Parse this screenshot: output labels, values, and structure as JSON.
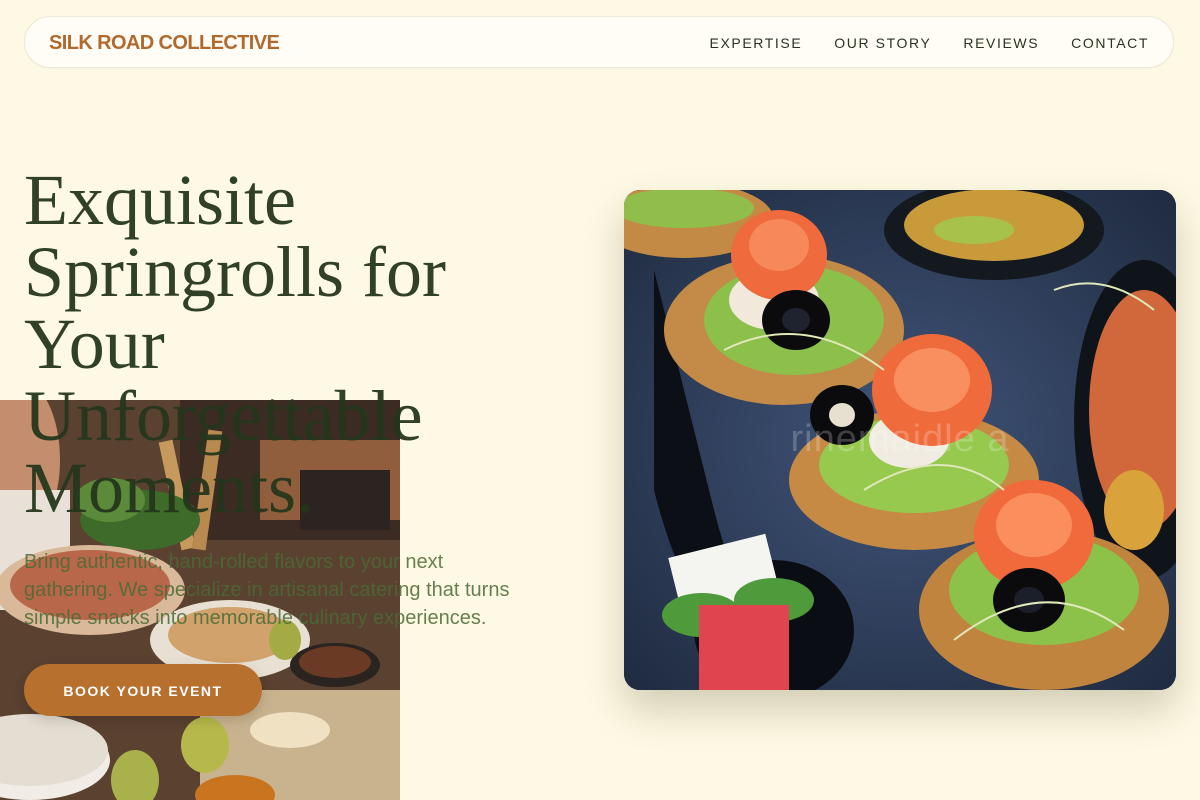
{
  "brand": {
    "name": "SILK ROAD COLLECTIVE",
    "color": "#b06a2d"
  },
  "nav": {
    "items": [
      {
        "label": "EXPERTISE"
      },
      {
        "label": "OUR STORY"
      },
      {
        "label": "REVIEWS"
      },
      {
        "label": "CONTACT"
      }
    ]
  },
  "hero": {
    "title": "Exquisite Springrolls for Your Unforgettable Moments.",
    "subtitle": "Bring authentic, hand-rolled flavors to your next gathering. We specialize in artisanal catering that turns simple snacks into memorable culinary experiences.",
    "cta_label": "BOOK YOUR EVENT"
  },
  "images": {
    "buffet": {
      "subject": "catering-buffet-photo"
    },
    "canapes": {
      "subject": "canapes-on-slate-photo",
      "watermark": "rinemaidle a"
    }
  },
  "colors": {
    "background": "#fef9e4",
    "accent": "#b8702f",
    "heading": "#24361c",
    "body_text": "#4c6a36"
  }
}
